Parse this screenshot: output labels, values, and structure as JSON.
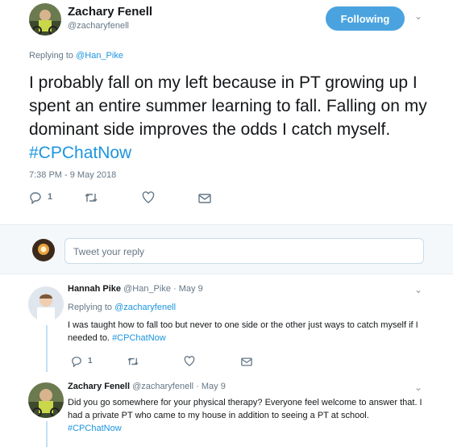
{
  "main_tweet": {
    "display_name": "Zachary Fenell",
    "handle": "@zacharyfenell",
    "follow_label": "Following",
    "replying_prefix": "Replying to ",
    "replying_handle": "@Han_Pike",
    "text": "I probably fall on my left because in PT growing up I spent an entire summer learning to fall. Falling on my dominant side improves the odds I catch myself. ",
    "hashtag": "#CPChatNow",
    "timestamp": "7:38 PM - 9 May 2018",
    "reply_count": "1"
  },
  "reply_composer": {
    "placeholder": "Tweet your reply"
  },
  "replies": [
    {
      "display_name": "Hannah Pike",
      "handle": "@Han_Pike",
      "date": "· May 9",
      "replying_prefix": "Replying to ",
      "replying_handle": "@zacharyfenell",
      "text": "I was taught how to fall too but never to one side or the other just ways to catch myself if I needed to. ",
      "hashtag": "#CPChatNow",
      "reply_count": "1"
    },
    {
      "display_name": "Zachary Fenell",
      "handle": "@zacharyfenell",
      "date": "· May 9",
      "text": "Did you go somewhere for your physical therapy? Everyone feel welcome to answer that. I had a private PT who came to my house in addition to seeing a PT at school. ",
      "hashtag": "#CPChatNow"
    }
  ],
  "colors": {
    "accent": "#1b95e0",
    "follow_button": "#4aa3df",
    "muted": "#657786"
  }
}
